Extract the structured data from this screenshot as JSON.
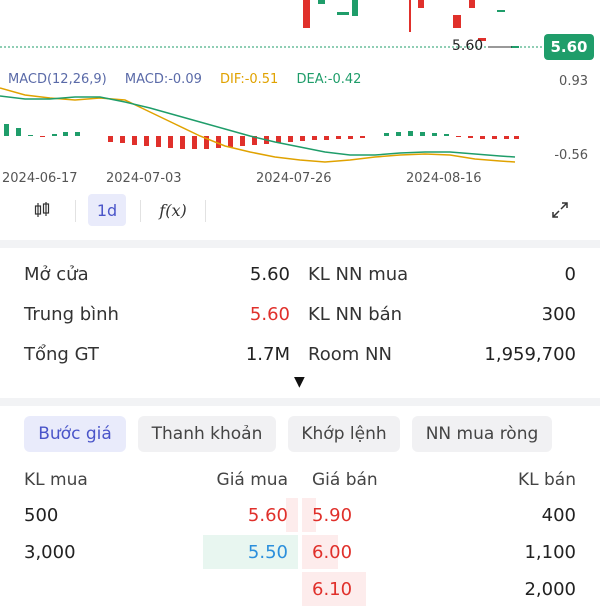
{
  "chart": {
    "last_price_tag": "5.60",
    "last_price_label": "5.60",
    "macd": {
      "name": "MACD(12,26,9)",
      "macd": "MACD:-0.09",
      "dif": "DIF:-0.51",
      "dea": "DEA:-0.42"
    },
    "axis_max": "0.93",
    "axis_min": "-0.56",
    "dates": [
      "2024-06-17",
      "2024-07-03",
      "2024-07-26",
      "2024-08-16"
    ],
    "colors": {
      "up": "#1f9d6a",
      "down": "#e0302b",
      "dif": "#e0a200",
      "dea": "#1f9d6a"
    }
  },
  "toolbar": {
    "candle_icon": "candlestick-icon",
    "interval": "1d",
    "fx_label": "f(x)",
    "expand_icon": "expand-icon"
  },
  "info": {
    "open_label": "Mở cửa",
    "open_value": "5.60",
    "avg_label": "Trung bình",
    "avg_value": "5.60",
    "total_label": "Tổng GT",
    "total_value": "1.7M",
    "nn_buy_label": "KL NN mua",
    "nn_buy_value": "0",
    "nn_sell_label": "KL NN bán",
    "nn_sell_value": "300",
    "room_label": "Room NN",
    "room_value": "1,959,700"
  },
  "tabs": [
    "Bước giá",
    "Thanh khoản",
    "Khớp lệnh",
    "NN mua ròng"
  ],
  "orderbook": {
    "headers": {
      "buy_vol": "KL mua",
      "buy_price": "Giá mua",
      "sell_price": "Giá bán",
      "sell_vol": "KL bán"
    },
    "rows": [
      {
        "buy_vol": "500",
        "buy_price": "5.60",
        "sell_price": "5.90",
        "sell_vol": "400"
      },
      {
        "buy_vol": "3,000",
        "buy_price": "5.50",
        "sell_price": "6.00",
        "sell_vol": "1,100"
      },
      {
        "buy_vol": "",
        "buy_price": "",
        "sell_price": "6.10",
        "sell_vol": "2,000"
      }
    ]
  }
}
